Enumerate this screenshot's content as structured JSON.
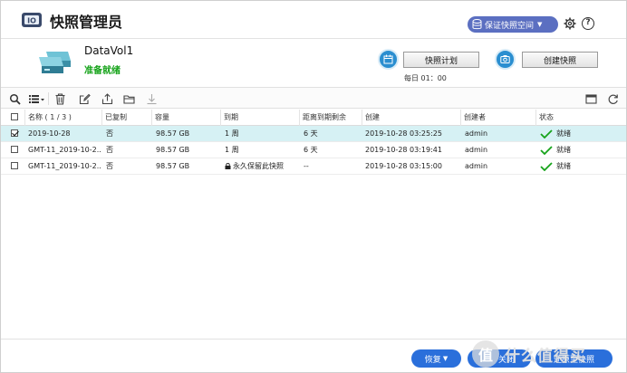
{
  "app": {
    "title": "快照管理员",
    "icon": "snapshot-app-icon"
  },
  "header": {
    "storage_space_label": "保证快照空间",
    "settings_icon": "gear-icon",
    "help_label": "?"
  },
  "volume": {
    "name": "DataVol1",
    "status": "准备就绪",
    "status_color": "#16a31a"
  },
  "actions": {
    "schedule_label": "快照计划",
    "schedule_time": "每日 01：00",
    "create_label": "创建快照"
  },
  "toolbar": {
    "icons": [
      "search-icon",
      "list-view-icon",
      "delete-icon",
      "edit-icon",
      "export-icon",
      "folder-icon",
      "download-icon",
      "window-icon",
      "refresh-icon"
    ]
  },
  "table": {
    "columns": {
      "name": "名称 ( 1 / 3 )",
      "copied": "已复制",
      "size": "容量",
      "expiry": "到期",
      "remaining": "距离到期剩余",
      "created": "创建",
      "creator": "创建者",
      "status": "状态"
    },
    "rows": [
      {
        "checked": true,
        "name": "2019-10-28",
        "copied": "否",
        "size": "98.57 GB",
        "expiry": "1 周",
        "remaining": "6 天",
        "created": "2019-10-28 03:25:25",
        "creator": "admin",
        "status": "就绪"
      },
      {
        "checked": false,
        "name": "GMT-11_2019-10-2...",
        "copied": "否",
        "size": "98.57 GB",
        "expiry": "1 周",
        "remaining": "6 天",
        "created": "2019-10-28 03:19:41",
        "creator": "admin",
        "status": "就绪"
      },
      {
        "checked": false,
        "name": "GMT-11_2019-10-2...",
        "copied": "否",
        "size": "98.57 GB",
        "expiry": "永久保留此快照",
        "remaining": "--",
        "created": "2019-10-28 03:15:00",
        "creator": "admin",
        "status": "就绪"
      }
    ]
  },
  "footer": {
    "restore_label": "恢复",
    "close_label": "关闭",
    "revert_label": "还原至快照",
    "watermark": "什么值得买",
    "watermark_badge": "值"
  },
  "colors": {
    "accent": "#2a8ed0",
    "pill": "#5b6fc1",
    "selected_row": "#d6f1f4",
    "primary_button": "#2a6fdb",
    "ready_check": "#16a31a"
  }
}
